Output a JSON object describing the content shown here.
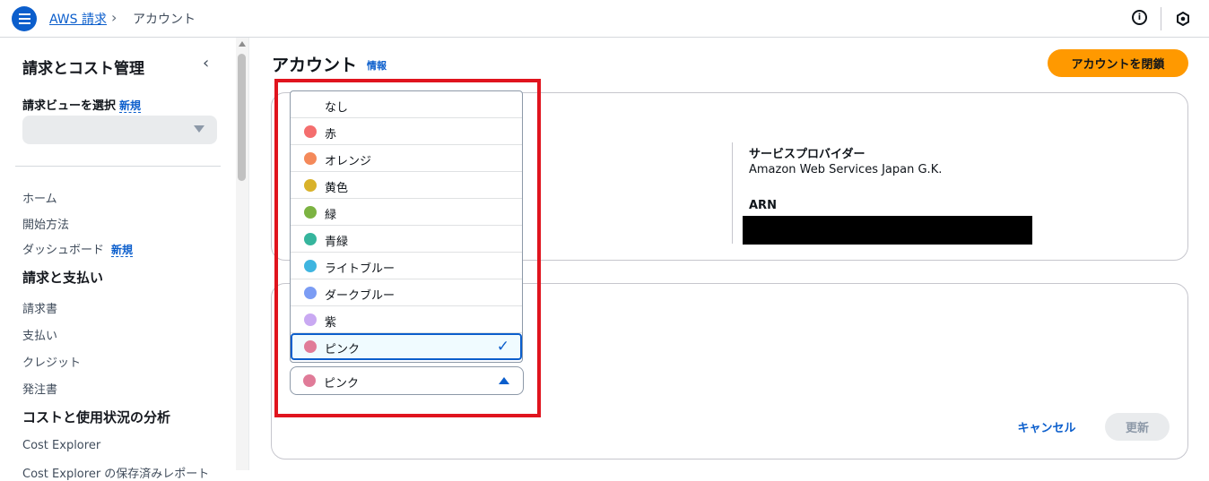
{
  "header": {
    "breadcrumb_link": "AWS 請求",
    "breadcrumb_sep": "›",
    "breadcrumb_current": "アカウント",
    "info_icon_glyph": "i"
  },
  "sidebar": {
    "title": "請求とコスト管理",
    "collapse_glyph": "‹",
    "view_label": "請求ビューを選択",
    "view_new": "新規",
    "items": {
      "home": "ホーム",
      "getting_started": "開始方法",
      "dashboard": "ダッシュボード",
      "dashboard_new": "新規",
      "section_billing": "請求と支払い",
      "invoices": "請求書",
      "payments": "支払い",
      "credits": "クレジット",
      "purchase_orders": "発注書",
      "section_cost": "コストと使用状況の分析",
      "cost_explorer": "Cost Explorer",
      "cost_explorer_saved": "Cost Explorer の保存済みレポート"
    }
  },
  "main": {
    "title": "アカウント",
    "info": "情報",
    "close_button": "アカウントを閉鎖",
    "provider_label": "サービスプロバイダー",
    "provider_value": "Amazon Web Services Japan G.K.",
    "arn_label": "ARN",
    "cancel": "キャンセル",
    "update": "更新"
  },
  "dropdown": {
    "options": [
      {
        "label": "なし",
        "color": ""
      },
      {
        "label": "赤",
        "color": "#f46e6e"
      },
      {
        "label": "オレンジ",
        "color": "#f4895a"
      },
      {
        "label": "黄色",
        "color": "#d9b22a"
      },
      {
        "label": "緑",
        "color": "#7cb342"
      },
      {
        "label": "青緑",
        "color": "#36b59d"
      },
      {
        "label": "ライトブルー",
        "color": "#3fb5e0"
      },
      {
        "label": "ダークブルー",
        "color": "#7b9cf4"
      },
      {
        "label": "紫",
        "color": "#c9a9f2"
      },
      {
        "label": "ピンク",
        "color": "#e07b98"
      }
    ],
    "selected": "ピンク",
    "selected_color": "#e07b98",
    "check_glyph": "✓"
  }
}
